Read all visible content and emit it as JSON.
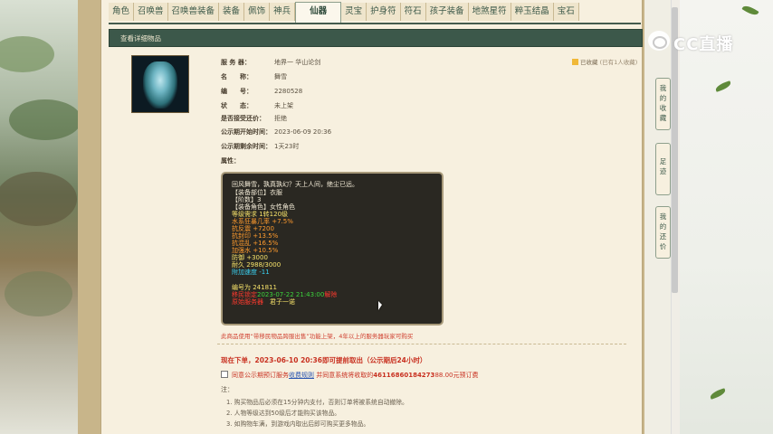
{
  "tabs": [
    "角色",
    "召唤兽",
    "召唤兽装备",
    "装备",
    "佩饰",
    "神兵",
    "仙器",
    "灵宝",
    "护身符",
    "符石",
    "孩子装备",
    "地煞星符",
    "粹玉结晶",
    "宝石"
  ],
  "active_tab": "仙器",
  "section_title": "查看详细物品",
  "watermark": "CC直播",
  "collect": {
    "label": "已收藏",
    "count": "(已有1人收藏)"
  },
  "info": [
    {
      "label": "服 务 器：",
      "value": "地界一 华山论剑"
    },
    {
      "label": "名　　称：",
      "value": "舞雪"
    },
    {
      "label": "编　　号：",
      "value": "2280528"
    },
    {
      "label": "状　　态：",
      "value": "未上架"
    },
    {
      "label": "是否接受还价：",
      "value": "拒绝"
    },
    {
      "label": "公示期开始时间：",
      "value": "2023-06-09 20:36"
    },
    {
      "label": "公示期剩余时间：",
      "value": "1天23时"
    },
    {
      "label": "属性：",
      "value": ""
    }
  ],
  "attributes": {
    "desc": "回风舞雪，孰真孰幻？天上人间，绝尘已远。",
    "part": "【装备部位】衣服",
    "tier": "【阶数】3",
    "role": "【装备角色】女性角色",
    "level_req": "等级需求 1转120级",
    "stat1": "水系狂暴几率 +7.5%",
    "stat2": "抗反震 +7200",
    "stat3": "抗封印 +13.5%",
    "stat4": "抗混乱 +16.5%",
    "stat5": "加强水 +10.5%",
    "defense": "防御 +3000",
    "durability": "耐久 2988/3000",
    "speed": "附加速度 -11",
    "serial": "编号为 241811",
    "transfer_prefix": "移民锁定",
    "transfer_time": "2023-07-22 21:43:00",
    "transfer_suffix": "解除",
    "origin_label": "原始服务器",
    "origin_value": "君子一诺"
  },
  "note_red": "此商品使用“带移民物品跨服出售”功能上架，4年以上的服务器玩家可购买",
  "publish": "现在下单，2023-06-10 20:36即可提前取出（公示期后24小时）",
  "agree": {
    "text1": "同意公示期预订服务",
    "link": "收费规则",
    "text2": "并同意系统将收取的",
    "amount": "46116860184273",
    "text3": "88.00元预订费"
  },
  "notes_title": "注：",
  "notes": [
    "1. 购买物品后必须在15分钟内支付，否则订单将被系统自动撤除。",
    "2. 人物等级达到50级后才能购买该物品。",
    "3. 如购物车满，到游戏内取出后即可购买更多物品。"
  ],
  "side_tabs": [
    {
      "label": [
        "我",
        "的",
        "收",
        "藏"
      ]
    },
    {
      "label": [
        "足",
        "迹"
      ]
    },
    {
      "label": [
        "我",
        "的",
        "还",
        "价"
      ]
    }
  ]
}
